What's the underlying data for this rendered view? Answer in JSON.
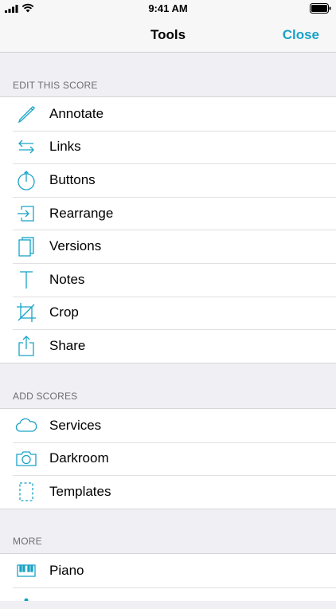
{
  "status_bar": {
    "time": "9:41 AM"
  },
  "nav": {
    "title": "Tools",
    "close_label": "Close"
  },
  "colors": {
    "accent": "#19a3c7",
    "background": "#efeff4",
    "header_text": "#6d6d72"
  },
  "sections": [
    {
      "header": "EDIT THIS SCORE",
      "items": [
        {
          "label": "Annotate",
          "icon": "pencil-icon"
        },
        {
          "label": "Links",
          "icon": "links-arrows-icon"
        },
        {
          "label": "Buttons",
          "icon": "button-hand-icon"
        },
        {
          "label": "Rearrange",
          "icon": "rearrange-icon"
        },
        {
          "label": "Versions",
          "icon": "versions-icon"
        },
        {
          "label": "Notes",
          "icon": "text-t-icon"
        },
        {
          "label": "Crop",
          "icon": "crop-icon"
        },
        {
          "label": "Share",
          "icon": "share-icon"
        }
      ]
    },
    {
      "header": "ADD SCORES",
      "items": [
        {
          "label": "Services",
          "icon": "cloud-icon"
        },
        {
          "label": "Darkroom",
          "icon": "camera-icon"
        },
        {
          "label": "Templates",
          "icon": "dashed-page-icon"
        }
      ]
    },
    {
      "header": "MORE",
      "items": [
        {
          "label": "Piano",
          "icon": "piano-keys-icon"
        }
      ]
    }
  ]
}
